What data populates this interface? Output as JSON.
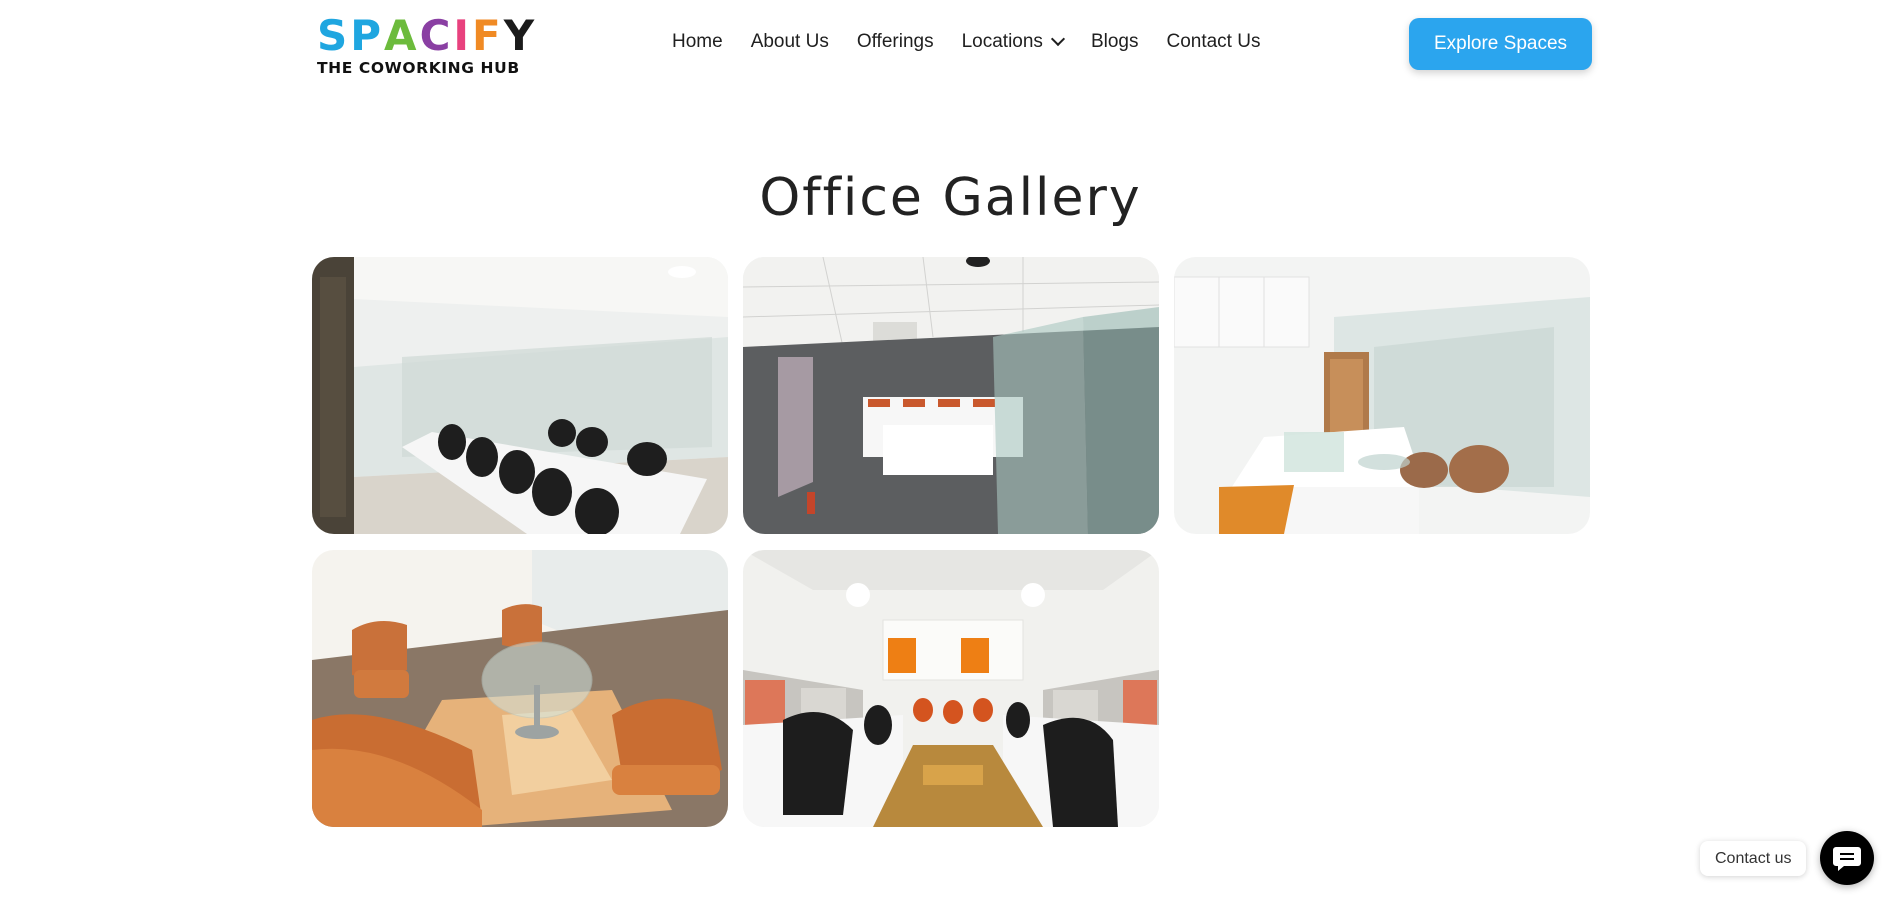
{
  "brand": {
    "logo_letters": [
      {
        "char": "S",
        "color": "#1fa6e0"
      },
      {
        "char": "P",
        "color": "#1fa6e0"
      },
      {
        "char": "A",
        "color": "#6cbb3c"
      },
      {
        "char": "C",
        "color": "#8a3fa3"
      },
      {
        "char": "I",
        "color": "#e8417e"
      },
      {
        "char": "F",
        "color": "#f08a24"
      },
      {
        "char": "Y",
        "color": "#1b1b1b"
      }
    ],
    "tagline": "THE COWORKING HUB"
  },
  "nav": {
    "items": [
      {
        "label": "Home"
      },
      {
        "label": "About Us"
      },
      {
        "label": "Offerings"
      },
      {
        "label": "Locations",
        "dropdown": true
      },
      {
        "label": "Blogs"
      },
      {
        "label": "Contact Us"
      }
    ]
  },
  "header": {
    "cta_label": "Explore Spaces",
    "cta_color": "#2ba5ee"
  },
  "main": {
    "title": "Office Gallery",
    "gallery": [
      {
        "scene": "conference-room"
      },
      {
        "scene": "open-workstations"
      },
      {
        "scene": "private-cabin"
      },
      {
        "scene": "lounge-seating"
      },
      {
        "scene": "workstation-aisle"
      }
    ]
  },
  "widget": {
    "label": "Contact us",
    "icon": "chat-icon"
  }
}
